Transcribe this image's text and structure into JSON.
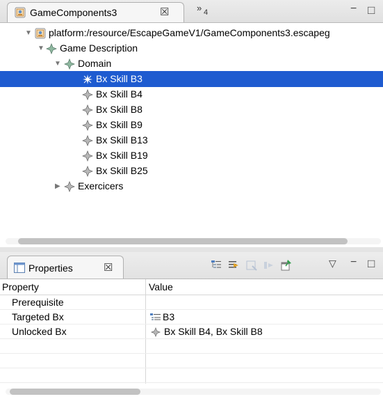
{
  "editor": {
    "tab_label": "GameComponents3",
    "tab_close": "☒",
    "overflow_chevron": "»",
    "overflow_count": "4",
    "minimize_glyph": "−",
    "maximize_glyph": "□"
  },
  "tree": {
    "root": "platform:/resource/EscapeGameV1/GameComponents3.escapeg",
    "game_description": "Game Description",
    "domain": "Domain",
    "skills": [
      "Bx Skill B3",
      "Bx Skill B4",
      "Bx Skill B8",
      "Bx Skill B9",
      "Bx Skill B13",
      "Bx Skill B19",
      "Bx Skill B25"
    ],
    "exercicers": "Exercicers",
    "selected_index": 0
  },
  "properties": {
    "tab_label": "Properties",
    "tab_close": "☒",
    "columns": [
      "Property",
      "Value"
    ],
    "rows": [
      {
        "name": "Prerequisite",
        "value": ""
      },
      {
        "name": "Targeted Bx",
        "value": "B3"
      },
      {
        "name": "Unlocked Bx",
        "value": "Bx Skill B4, Bx Skill B8"
      }
    ],
    "menu_glyph": "▽",
    "minimize_glyph": "−",
    "maximize_glyph": "□"
  },
  "colors": {
    "selection": "#1e5bd0",
    "diamond_icon": "#7c8c8c",
    "resource_icon": "#c8893a"
  },
  "icons": {
    "resource": "resource-file-icon",
    "element": "diamond-element-icon",
    "selected_element": "sparkle-element-icon",
    "list": "list-value-icon"
  }
}
